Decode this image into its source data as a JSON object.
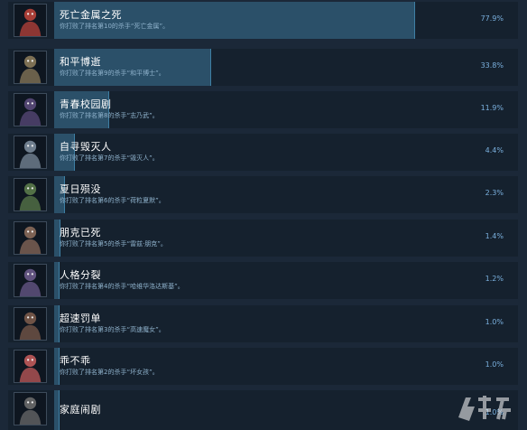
{
  "achievements": [
    {
      "title": "死亡金属之死",
      "desc": "你打败了排名第10的杀手“死亡金属”。",
      "percent": "77.9%",
      "fill": 0.779,
      "icon": "character-portrait-icon",
      "color": "#b8423a"
    },
    {
      "title": "和平博逝",
      "desc": "你打败了排名第9的杀手“和平博士”。",
      "percent": "33.8%",
      "fill": 0.338,
      "icon": "character-portrait-icon",
      "color": "#8a7a5a"
    },
    {
      "title": "青春校园剧",
      "desc": "你打败了排名第8的杀手“志乃武”。",
      "percent": "11.9%",
      "fill": 0.119,
      "icon": "character-portrait-icon",
      "color": "#5a4a7a"
    },
    {
      "title": "自寻毁灭人",
      "desc": "你打败了排名第7的杀手“毁灭人”。",
      "percent": "4.4%",
      "fill": 0.044,
      "icon": "character-portrait-icon",
      "color": "#7a8a9a"
    },
    {
      "title": "夏日殒没",
      "desc": "你打败了排名第6的杀手“荷粒夏默”。",
      "percent": "2.3%",
      "fill": 0.023,
      "icon": "character-portrait-icon",
      "color": "#5a7a4a"
    },
    {
      "title": "朋克已死",
      "desc": "你打败了排名第5的杀手“雷兹·朋克”。",
      "percent": "1.4%",
      "fill": 0.014,
      "icon": "character-portrait-icon",
      "color": "#8a6a5a"
    },
    {
      "title": "人格分裂",
      "desc": "你打败了排名第4的杀手“哈维华洛达斯基”。",
      "percent": "1.2%",
      "fill": 0.012,
      "icon": "character-portrait-icon",
      "color": "#6a5a8a"
    },
    {
      "title": "超速罚单",
      "desc": "你打败了排名第3的杀手“高速魔女”。",
      "percent": "1.0%",
      "fill": 0.01,
      "icon": "character-portrait-icon",
      "color": "#7a5a4a"
    },
    {
      "title": "乖不乖",
      "desc": "你打败了排名第2的杀手“坏女孩”。",
      "percent": "1.0%",
      "fill": 0.01,
      "icon": "character-portrait-icon",
      "color": "#c05a5a"
    },
    {
      "title": "家庭闹剧",
      "desc": "",
      "percent": "1.0%",
      "fill": 0.01,
      "icon": "character-portrait-icon",
      "color": "#6a6a6a"
    }
  ]
}
